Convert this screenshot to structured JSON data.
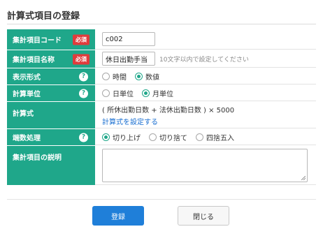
{
  "page": {
    "title": "計算式項目の登録"
  },
  "rows": {
    "code": {
      "label": "集計項目コード",
      "badge": "必須",
      "value": "c002"
    },
    "name": {
      "label": "集計項目名称",
      "badge": "必須",
      "value": "休日出勤手当",
      "hint": "10文字以内で設定してください"
    },
    "display": {
      "label": "表示形式",
      "help": "?",
      "options": [
        "時間",
        "数値"
      ],
      "selected": "数値"
    },
    "unit": {
      "label": "計算単位",
      "help": "?",
      "options": [
        "日単位",
        "月単位"
      ],
      "selected": "月単位"
    },
    "formula": {
      "label": "計算式",
      "value": "( 所休出勤日数 + 法休出勤日数 ) × 5000",
      "link": "計算式を設定する"
    },
    "rounding": {
      "label": "端数処理",
      "help": "?",
      "options": [
        "切り上げ",
        "切り捨て",
        "四捨五入"
      ],
      "selected": "切り上げ"
    },
    "description": {
      "label": "集計項目の説明",
      "value": ""
    }
  },
  "buttons": {
    "register": "登録",
    "close": "閉じる"
  },
  "colors": {
    "label_bg": "#1fa78a",
    "required_badge": "#e03c3c",
    "primary": "#1f7fd9",
    "link": "#1a6fd1"
  }
}
